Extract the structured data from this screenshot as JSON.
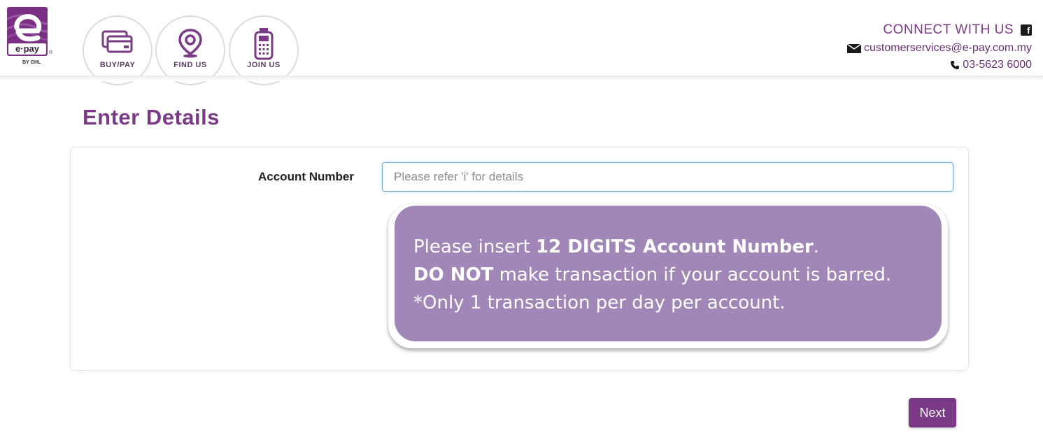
{
  "brand": {
    "logo_pay": "e·pay",
    "logo_reg": "®",
    "logo_by": "BY GHL",
    "color": "#7b3a86"
  },
  "nav": [
    {
      "label": "BUY/PAY",
      "icon": "card-icon"
    },
    {
      "label": "FIND US",
      "icon": "map-pin-icon"
    },
    {
      "label": "JOIN US",
      "icon": "terminal-icon"
    }
  ],
  "connect": {
    "title": "CONNECT WITH US",
    "email": "customerservices@e-pay.com.my",
    "phone": "03-5623 6000"
  },
  "main": {
    "title": "Enter Details",
    "account_label": "Account Number",
    "account_placeholder": "Please refer 'i' for details",
    "account_value": "",
    "info": {
      "line1_pre": "Please insert ",
      "line1_bold": "12 DIGITS Account Number",
      "line1_post": ".",
      "line2_bold": "DO NOT",
      "line2_post": " make transaction if your account is barred.",
      "line3": "*Only 1 transaction per day per account."
    },
    "next_label": "Next"
  }
}
